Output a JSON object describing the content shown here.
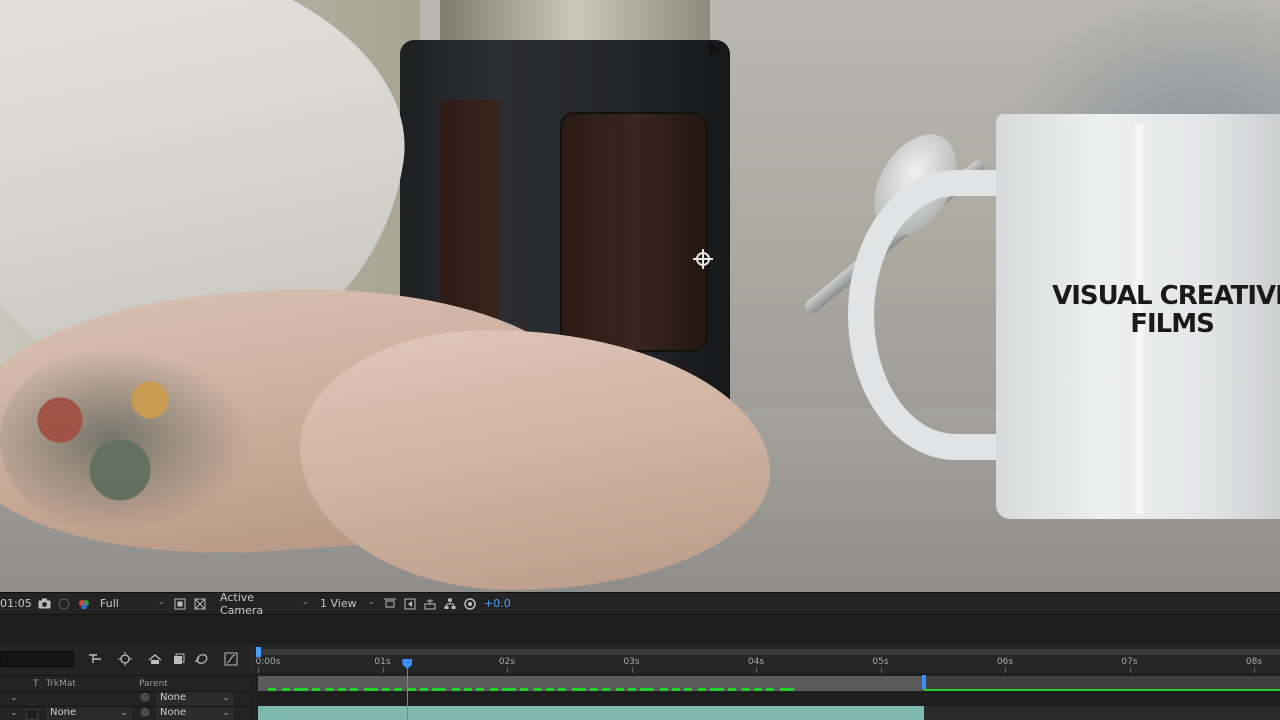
{
  "viewer": {
    "mug_logo_line1": "VISUAL CREATIVE",
    "mug_logo_line2": "FILMS"
  },
  "viewer_toolbar": {
    "timecode": "01:05",
    "resolution": "Full",
    "camera": "Active Camera",
    "views": "1 View",
    "exposure": "+0.0",
    "icons": [
      "camera-icon",
      "channel-icon",
      "color-wheel-icon",
      "region-icon",
      "transparency-grid-icon",
      "fit-icon",
      "fast-preview-icon",
      "3d-draft-icon",
      "flowchart-icon",
      "exposure-reset-icon"
    ]
  },
  "timeline": {
    "column_headers": {
      "t": "T",
      "trkmat": "TrkMat",
      "parent": "Parent"
    },
    "layers": [
      {
        "trkmat": "",
        "parent": "None"
      },
      {
        "trkmat": "None",
        "parent": "None"
      }
    ],
    "ruler": {
      "ticks": [
        "0:00s",
        "01s",
        "02s",
        "03s",
        "04s",
        "05s",
        "06s",
        "07s",
        "08s"
      ],
      "duration_seconds": 8,
      "playhead_seconds": 1.2,
      "layer_end_seconds": 5.35
    },
    "colors": {
      "playhead": "#3b8fff",
      "keyframe_track": "#22d12a",
      "layer_bar_video": "#7fb8ae",
      "layer_bar_adjust": "#5b5b5b"
    }
  }
}
